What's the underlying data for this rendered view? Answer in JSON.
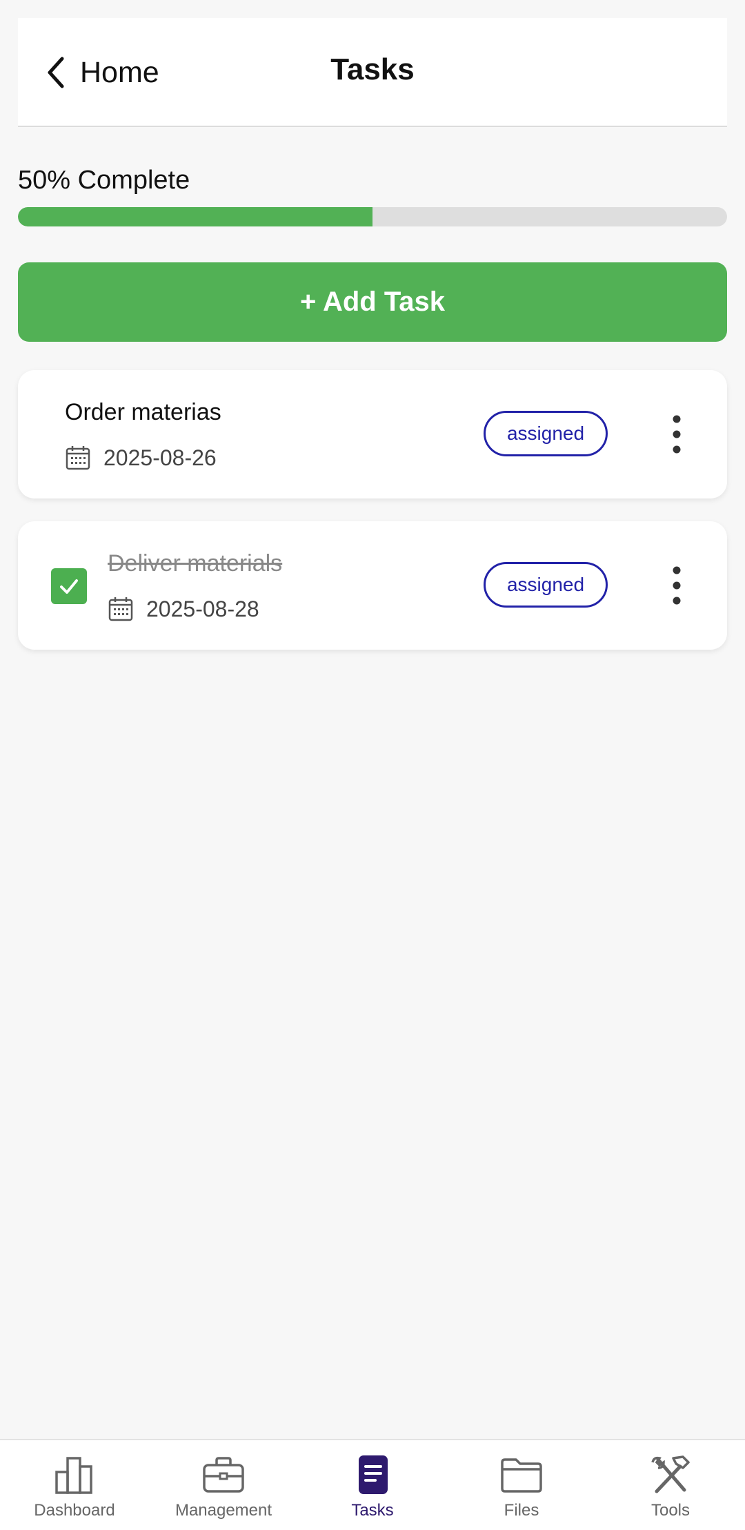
{
  "header": {
    "back_label": "Home",
    "title": "Tasks"
  },
  "progress": {
    "label": "50% Complete",
    "percent": 50,
    "color": "#52b155"
  },
  "add_task": {
    "label": "+ Add Task"
  },
  "tasks": [
    {
      "name": "Order materias",
      "date": "2025-08-26",
      "status": "assigned",
      "completed": false
    },
    {
      "name": "Deliver materials",
      "date": "2025-08-28",
      "status": "assigned",
      "completed": true
    }
  ],
  "nav": {
    "items": [
      {
        "label": "Dashboard",
        "icon": "bar-chart-icon"
      },
      {
        "label": "Management",
        "icon": "briefcase-icon"
      },
      {
        "label": "Tasks",
        "icon": "document-icon",
        "active": true
      },
      {
        "label": "Files",
        "icon": "folder-icon"
      },
      {
        "label": "Tools",
        "icon": "tools-icon"
      }
    ]
  },
  "colors": {
    "accent": "#52b155",
    "badge": "#2222a8",
    "active_nav": "#2e1a6e"
  }
}
